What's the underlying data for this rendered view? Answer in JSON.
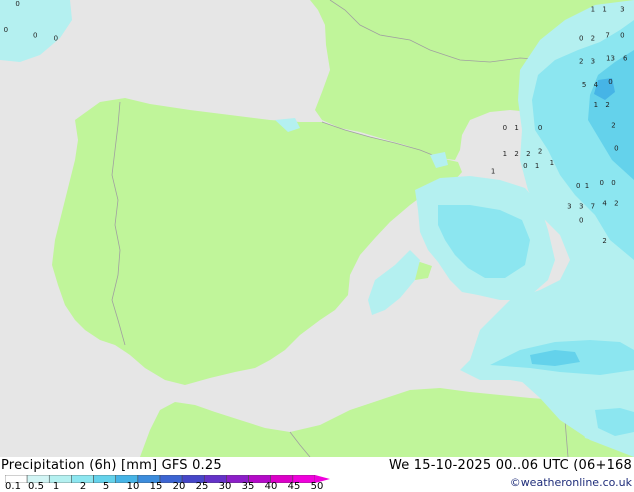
{
  "product": {
    "title": "Precipitation (6h) [mm] GFS 0.25",
    "datetime": "We 15-10-2025 00..06 UTC (06+168",
    "credit": "©weatheronline.co.uk"
  },
  "legend": {
    "ticks": [
      "0.1",
      "0.5",
      "1",
      "2",
      "5",
      "10",
      "15",
      "20",
      "25",
      "30",
      "35",
      "40",
      "45",
      "50"
    ],
    "colors": [
      "#ffffff",
      "#d2f5f5",
      "#b4f0f0",
      "#8ce6f0",
      "#64d2eb",
      "#46b4e6",
      "#3c8cdc",
      "#3c64d2",
      "#4646c8",
      "#6432c8",
      "#8c1ec8",
      "#b40ac8",
      "#dc00c8",
      "#f000dc"
    ]
  },
  "colors": {
    "land": "#c0f59a",
    "sea": "#e6e6e6",
    "border": "#a0a0a0",
    "precip_light": "#b4f0f0",
    "precip_mid": "#8ce6f0",
    "precip_heavy": "#64d2eb",
    "precip_strong": "#46b4e6"
  },
  "values": [
    {
      "text": "0",
      "lon": -14.4,
      "lat": 49.8
    },
    {
      "text": "0",
      "lon": -14.8,
      "lat": 48.9
    },
    {
      "text": "0",
      "lon": -13.8,
      "lat": 48.7
    },
    {
      "text": "0",
      "lon": -13.1,
      "lat": 48.6
    },
    {
      "text": "1",
      "lon": 5.2,
      "lat": 49.6
    },
    {
      "text": "1",
      "lon": 5.6,
      "lat": 49.6
    },
    {
      "text": "3",
      "lon": 6.2,
      "lat": 49.6
    },
    {
      "text": "0",
      "lon": 4.8,
      "lat": 48.6
    },
    {
      "text": "2",
      "lon": 5.2,
      "lat": 48.6
    },
    {
      "text": "7",
      "lon": 5.7,
      "lat": 48.7
    },
    {
      "text": "0",
      "lon": 6.2,
      "lat": 48.7
    },
    {
      "text": "2",
      "lon": 4.8,
      "lat": 47.8
    },
    {
      "text": "3",
      "lon": 5.2,
      "lat": 47.8
    },
    {
      "text": "13",
      "lon": 5.8,
      "lat": 47.9
    },
    {
      "text": "6",
      "lon": 6.3,
      "lat": 47.9
    },
    {
      "text": "5",
      "lon": 4.9,
      "lat": 47.0
    },
    {
      "text": "4",
      "lon": 5.3,
      "lat": 47.0
    },
    {
      "text": "0",
      "lon": 5.8,
      "lat": 47.1
    },
    {
      "text": "1",
      "lon": 5.3,
      "lat": 46.3
    },
    {
      "text": "2",
      "lon": 5.7,
      "lat": 46.3
    },
    {
      "text": "2",
      "lon": 5.9,
      "lat": 45.6
    },
    {
      "text": "0",
      "lon": 6.0,
      "lat": 44.8
    },
    {
      "text": "0",
      "lon": 2.2,
      "lat": 45.5
    },
    {
      "text": "1",
      "lon": 2.6,
      "lat": 45.5
    },
    {
      "text": "0",
      "lon": 3.4,
      "lat": 45.5
    },
    {
      "text": "1",
      "lon": 2.2,
      "lat": 44.6
    },
    {
      "text": "2",
      "lon": 2.6,
      "lat": 44.6
    },
    {
      "text": "2",
      "lon": 3.0,
      "lat": 44.6
    },
    {
      "text": "2",
      "lon": 3.4,
      "lat": 44.7
    },
    {
      "text": "0",
      "lon": 2.9,
      "lat": 44.2
    },
    {
      "text": "1",
      "lon": 3.3,
      "lat": 44.2
    },
    {
      "text": "1",
      "lon": 3.8,
      "lat": 44.3
    },
    {
      "text": "1",
      "lon": 1.8,
      "lat": 44.0
    },
    {
      "text": "0",
      "lon": 4.7,
      "lat": 43.5
    },
    {
      "text": "1",
      "lon": 5.0,
      "lat": 43.5
    },
    {
      "text": "0",
      "lon": 5.5,
      "lat": 43.6
    },
    {
      "text": "0",
      "lon": 5.9,
      "lat": 43.6
    },
    {
      "text": "3",
      "lon": 4.4,
      "lat": 42.8
    },
    {
      "text": "3",
      "lon": 4.8,
      "lat": 42.8
    },
    {
      "text": "7",
      "lon": 5.2,
      "lat": 42.8
    },
    {
      "text": "4",
      "lon": 5.6,
      "lat": 42.9
    },
    {
      "text": "2",
      "lon": 6.0,
      "lat": 42.9
    },
    {
      "text": "0",
      "lon": 4.8,
      "lat": 42.3
    },
    {
      "text": "2",
      "lon": 5.6,
      "lat": 41.6
    }
  ]
}
